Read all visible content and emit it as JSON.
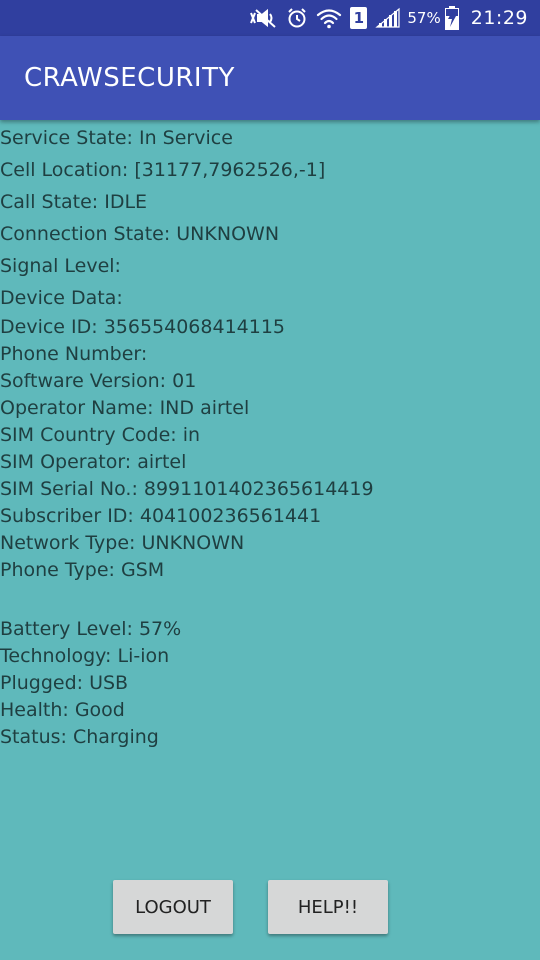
{
  "status_bar": {
    "sim_slot": "1",
    "battery_percent": "57%",
    "time": "21:29",
    "icons": [
      "mute-icon",
      "alarm-icon",
      "wifi-icon",
      "sim-slot-icon",
      "signal-icon",
      "battery-charging-icon"
    ]
  },
  "app_bar": {
    "title": "CRAWSECURITY"
  },
  "telephony": [
    "Service State:  In Service",
    "Cell Location:  [31177,7962526,-1]",
    "Call State:  IDLE",
    "Connection State:  UNKNOWN",
    "Signal Level:",
    "Device Data:"
  ],
  "device": [
    "Device ID: 356554068414115",
    "Phone Number:",
    "Software Version: 01",
    "Operator Name: IND airtel",
    "SIM Country Code: in",
    "SIM Operator: airtel",
    "SIM Serial No.: 8991101402365614419",
    "Subscriber ID: 404100236561441",
    "Network Type: UNKNOWN",
    "Phone Type: GSM"
  ],
  "battery": [
    "Battery Level: 57%",
    "Technology: Li-ion",
    "Plugged: USB",
    "Health: Good",
    "Status: Charging"
  ],
  "buttons": {
    "logout": "LOGOUT",
    "help": "HELP!!"
  },
  "colors": {
    "status_bar": "#303f9f",
    "app_bar": "#3f51b5",
    "background": "#5fb9bb",
    "text": "#1f3f41",
    "button": "#d6d7d7"
  }
}
